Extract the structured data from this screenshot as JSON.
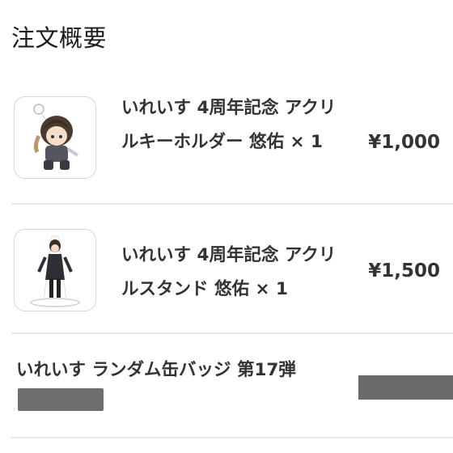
{
  "section": {
    "title": "注文概要"
  },
  "items": [
    {
      "name": "いれいす 4周年記念 アクリルキーホルダー 悠佑 × 1",
      "price": "¥1,000",
      "thumbnail_icon": "acrylic-keychain-image"
    },
    {
      "name": "いれいす 4周年記念 アクリルスタンド 悠佑 × 1",
      "price": "¥1,500",
      "thumbnail_icon": "acrylic-stand-image"
    },
    {
      "name": "いれいす ランダム缶バッジ 第17弾",
      "price": "",
      "redacted": true
    }
  ],
  "colors": {
    "text": "#333333",
    "divider": "#e6e6e6",
    "redaction": "#6a6a6a"
  }
}
